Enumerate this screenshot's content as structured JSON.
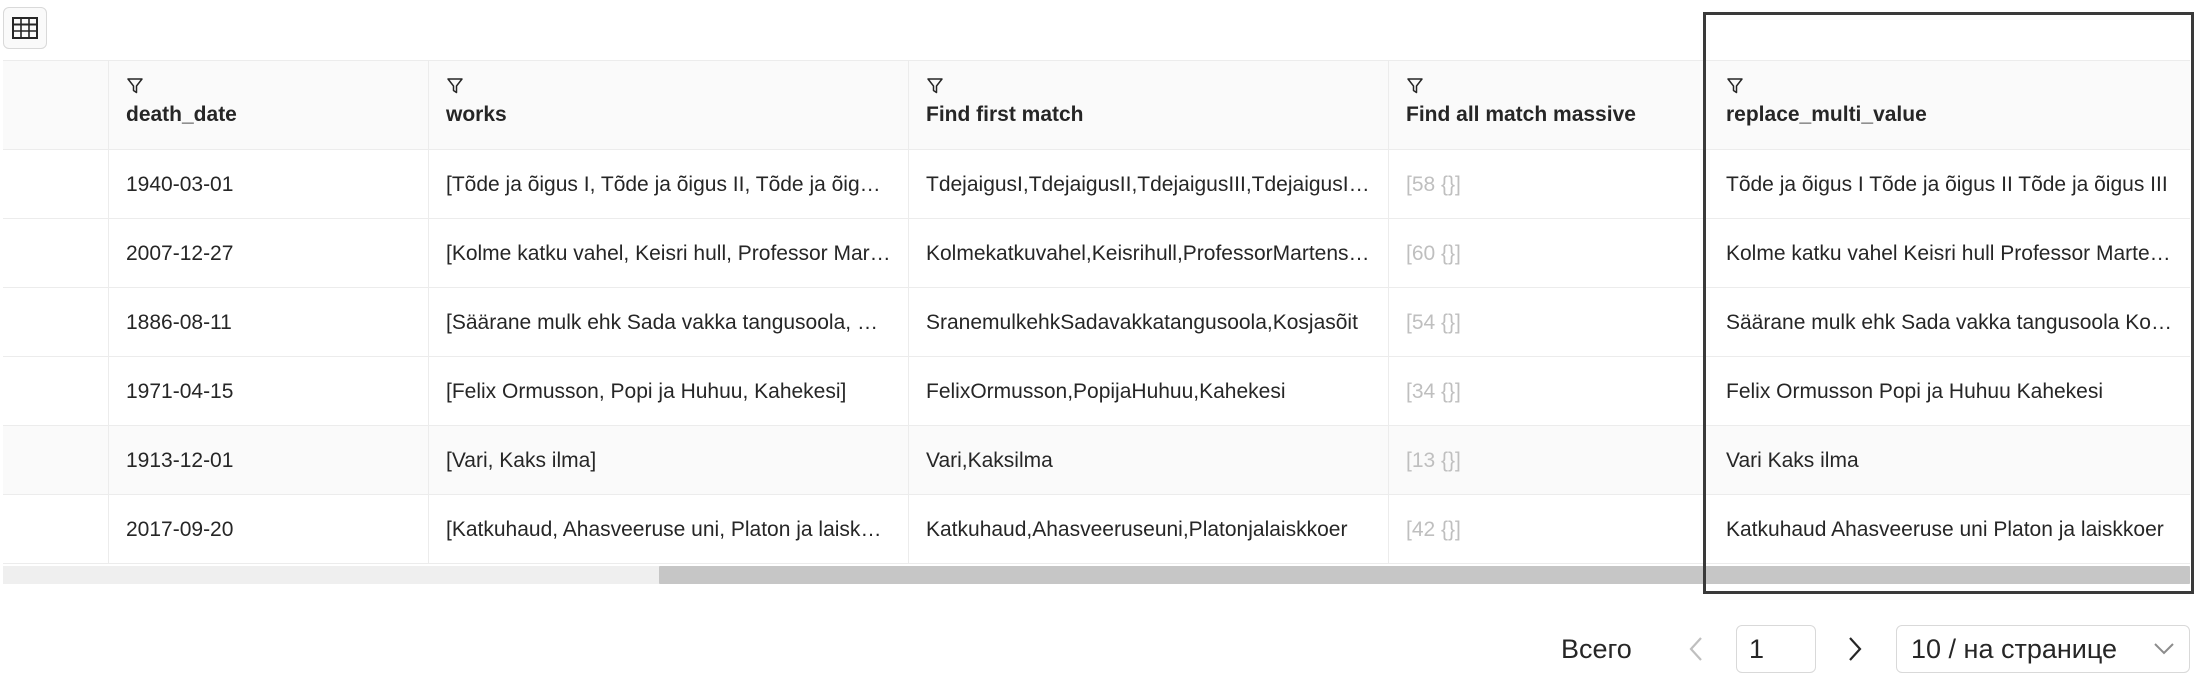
{
  "icons": {
    "table_toggle": "table-grid-icon",
    "column_filter": "filter-funnel-icon",
    "prev": "chevron-left-icon",
    "next": "chevron-right-icon",
    "dropdown": "chevron-down-icon"
  },
  "colors": {
    "header_bg": "#fafafa",
    "border": "#ececec",
    "muted_text": "#bfbfbf",
    "highlight_border": "#3a3a3a",
    "scroll_thumb": "#c6c6c6"
  },
  "table": {
    "columns": [
      {
        "label": ""
      },
      {
        "label": "death_date"
      },
      {
        "label": "works"
      },
      {
        "label": "Find first match"
      },
      {
        "label": "Find all match massive"
      },
      {
        "label": "replace_multi_value"
      }
    ],
    "rows": [
      [
        "",
        "1940-03-01",
        "[Tõde ja õigus I, Tõde ja õigus II, Tõde ja õigus III, Tõde ja õigus IV, Tõde ja õigus V]",
        "TdejaigusI,TdejaigusII,TdejaigusIII,TdejaigusIV,TdejaigusV",
        "[58 {}]",
        "Tõde ja õigus I Tõde ja õigus II Tõde ja õigus III"
      ],
      [
        "",
        "2007-12-27",
        "[Kolme katku vahel, Keisri hull, Professor Martensi ärasõit]",
        "Kolmekatkuvahel,Keisrihull,ProfessorMartensiärasõit",
        "[60 {}]",
        "Kolme katku vahel Keisri hull Professor Martensi ärasõit"
      ],
      [
        "",
        "1886-08-11",
        "[Säärane mulk ehk Sada vakka tangusoola, Kosjasõit]",
        "SranemulkehkSadavakkatangusoola,Kosjasõit",
        "[54 {}]",
        "Säärane mulk ehk Sada vakka tangusoola Kosjasõit"
      ],
      [
        "",
        "1971-04-15",
        "[Felix Ormusson, Popi ja Huhuu, Kahekesi]",
        "FelixOrmusson,PopijaHuhuu,Kahekesi",
        "[34 {}]",
        "Felix Ormusson Popi ja Huhuu Kahekesi"
      ],
      [
        "",
        "1913-12-01",
        "[Vari, Kaks ilma]",
        "Vari,Kaksilma",
        "[13 {}]",
        "Vari Kaks ilma"
      ],
      [
        "",
        "2017-09-20",
        "[Katkuhaud, Ahasveeruse uni, Platon ja laiskkoer]",
        "Katkuhaud,Ahasveeruseuni,Platonjalaiskkoer",
        "[42 {}]",
        "Katkuhaud Ahasveeruse uni Platon ja laiskkoer"
      ]
    ]
  },
  "scroll": {
    "thumb_start": 0.3,
    "thumb_end": 1.0
  },
  "pagination": {
    "total_label": "Всего",
    "current_page": "1",
    "page_size_label": "10 / на странице"
  }
}
